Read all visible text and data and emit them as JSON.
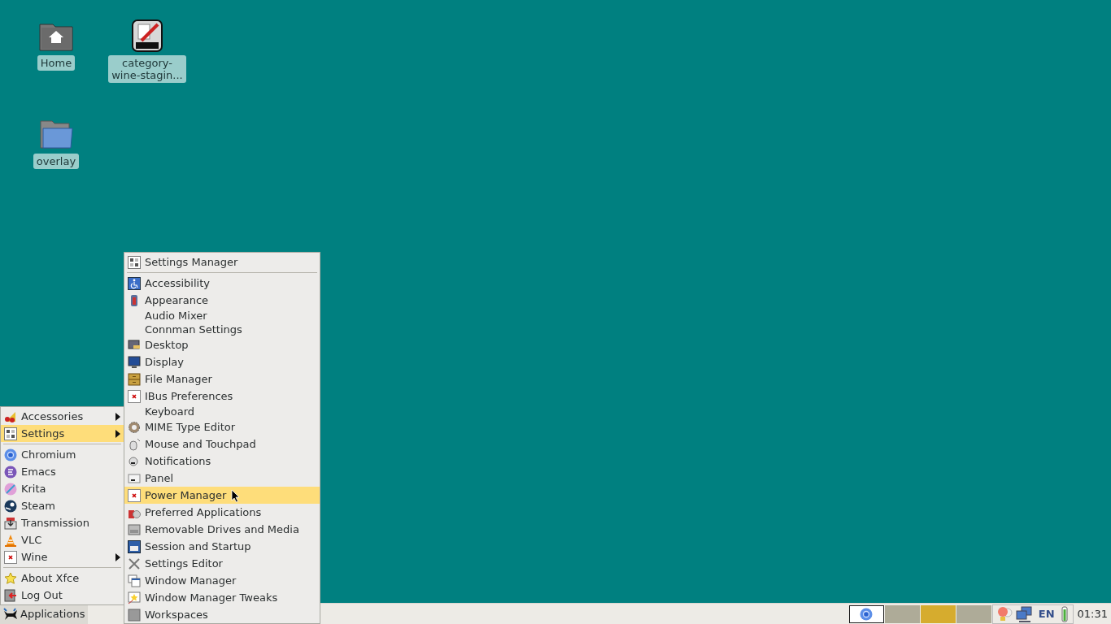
{
  "desktop_icons": [
    {
      "label": "Home"
    },
    {
      "label": "category-\nwine-stagin..."
    },
    {
      "label": "overlay"
    }
  ],
  "applications_menu": [
    {
      "kind": "item",
      "label": "Accessories",
      "submenu": true,
      "selected": false
    },
    {
      "kind": "item",
      "label": "Settings",
      "submenu": true,
      "selected": true
    },
    {
      "kind": "separator"
    },
    {
      "kind": "item",
      "label": "Chromium",
      "submenu": false,
      "selected": false
    },
    {
      "kind": "item",
      "label": "Emacs",
      "submenu": false,
      "selected": false
    },
    {
      "kind": "item",
      "label": "Krita",
      "submenu": false,
      "selected": false
    },
    {
      "kind": "item",
      "label": "Steam",
      "submenu": false,
      "selected": false
    },
    {
      "kind": "item",
      "label": "Transmission",
      "submenu": false,
      "selected": false
    },
    {
      "kind": "item",
      "label": "VLC",
      "submenu": false,
      "selected": false
    },
    {
      "kind": "item",
      "label": "Wine",
      "submenu": true,
      "selected": false
    },
    {
      "kind": "separator"
    },
    {
      "kind": "item",
      "label": "About Xfce",
      "submenu": false,
      "selected": false
    },
    {
      "kind": "item",
      "label": "Log Out",
      "submenu": false,
      "selected": false
    }
  ],
  "settings_menu": [
    {
      "kind": "item",
      "label": "Settings Manager",
      "selected": false
    },
    {
      "kind": "separator"
    },
    {
      "kind": "item",
      "label": "Accessibility",
      "selected": false
    },
    {
      "kind": "item",
      "label": "Appearance",
      "selected": false
    },
    {
      "kind": "item",
      "label": "Audio Mixer",
      "selected": false
    },
    {
      "kind": "item",
      "label": "Connman Settings",
      "selected": false
    },
    {
      "kind": "item",
      "label": "Desktop",
      "selected": false
    },
    {
      "kind": "item",
      "label": "Display",
      "selected": false
    },
    {
      "kind": "item",
      "label": "File Manager",
      "selected": false
    },
    {
      "kind": "item",
      "label": "IBus Preferences",
      "selected": false
    },
    {
      "kind": "item",
      "label": "Keyboard",
      "selected": false
    },
    {
      "kind": "item",
      "label": "MIME Type Editor",
      "selected": false
    },
    {
      "kind": "item",
      "label": "Mouse and Touchpad",
      "selected": false
    },
    {
      "kind": "item",
      "label": "Notifications",
      "selected": false
    },
    {
      "kind": "item",
      "label": "Panel",
      "selected": false
    },
    {
      "kind": "item",
      "label": "Power Manager",
      "selected": true
    },
    {
      "kind": "item",
      "label": "Preferred Applications",
      "selected": false
    },
    {
      "kind": "item",
      "label": "Removable Drives and Media",
      "selected": false
    },
    {
      "kind": "item",
      "label": "Session and Startup",
      "selected": false
    },
    {
      "kind": "item",
      "label": "Settings Editor",
      "selected": false
    },
    {
      "kind": "item",
      "label": "Window Manager",
      "selected": false
    },
    {
      "kind": "item",
      "label": "Window Manager Tweaks",
      "selected": false
    },
    {
      "kind": "item",
      "label": "Workspaces",
      "selected": false
    }
  ],
  "panel": {
    "applications_button": {
      "label": "Applications",
      "selected": true
    },
    "workspaces": [
      {
        "selected": false
      },
      {
        "selected": true
      },
      {
        "selected": false
      }
    ],
    "keyboard_layout": "EN",
    "clock": "01:31"
  }
}
